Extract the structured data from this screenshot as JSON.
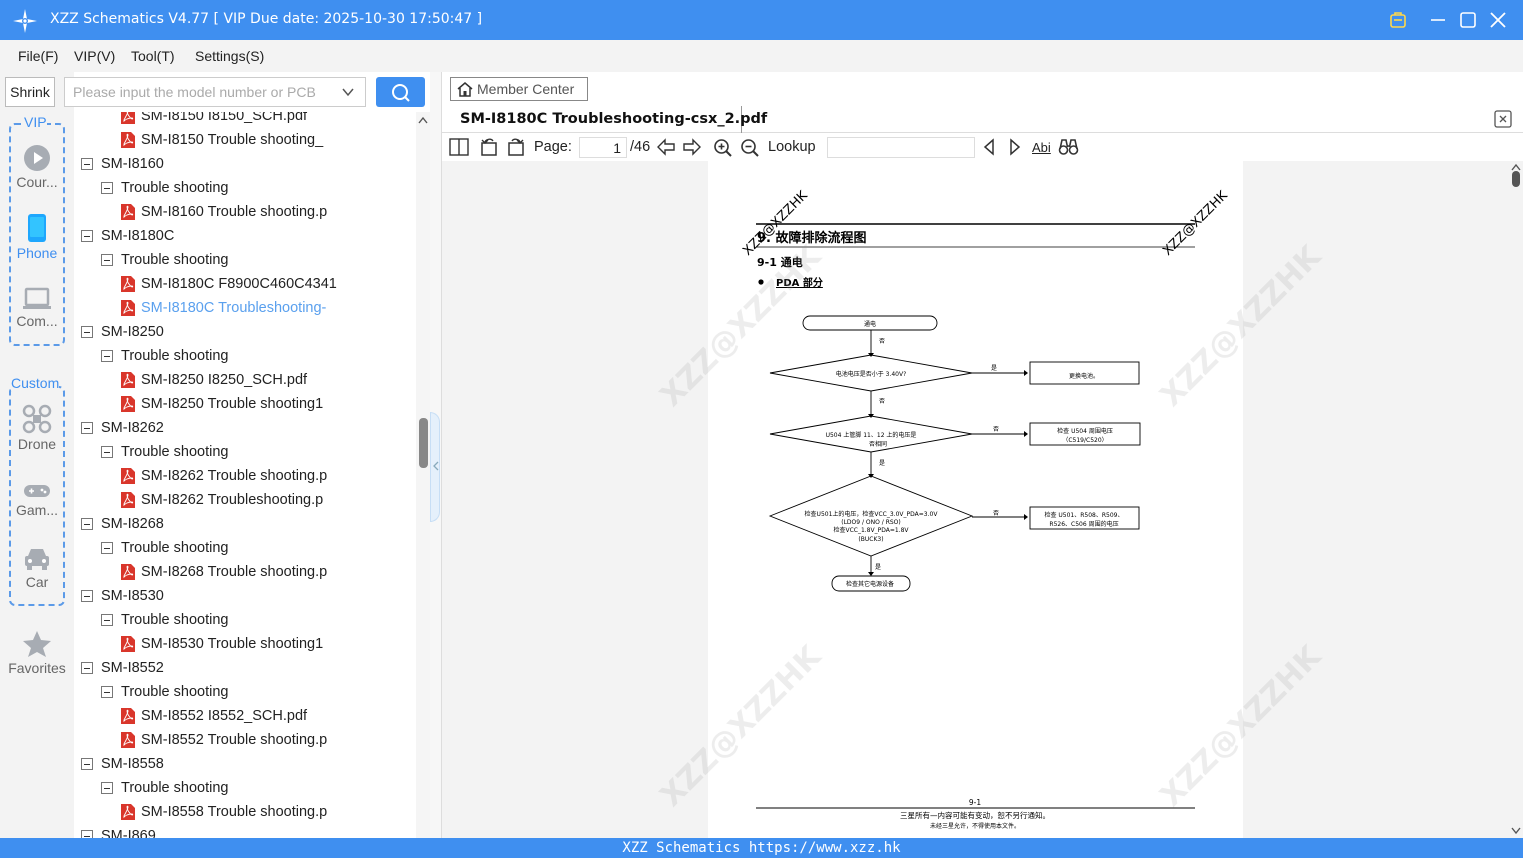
{
  "window": {
    "title": "XZZ Schematics V4.77 [ VIP Due date: 2025-10-30 17:50:47 ]",
    "accent": "#3f8ff0"
  },
  "menu": [
    "File(F)",
    "VIP(V)",
    "Tool(T)",
    "Settings(S)"
  ],
  "search": {
    "shrink_label": "Shrink",
    "placeholder": "Please input the model number or PCB"
  },
  "sidebar": {
    "vip_group": "VIP",
    "custom_group": "Custom",
    "categories": [
      {
        "label": "Cour...",
        "icon": "play-icon"
      },
      {
        "label": "Phone",
        "icon": "phone-icon"
      },
      {
        "label": "Com...",
        "icon": "laptop-icon"
      },
      {
        "label": "Drone",
        "icon": "drone-icon"
      },
      {
        "label": "Gam...",
        "icon": "gamepad-icon"
      },
      {
        "label": "Car",
        "icon": "car-icon"
      },
      {
        "label": "Favorites",
        "icon": "star-icon"
      }
    ]
  },
  "tree": [
    {
      "level": 2,
      "type": "pdf",
      "text": "SM-I8150 I8150_SCH.pdf"
    },
    {
      "level": 2,
      "type": "pdf",
      "text": "SM-I8150 Trouble shooting_"
    },
    {
      "level": 0,
      "type": "folder",
      "text": "SM-I8160"
    },
    {
      "level": 1,
      "type": "folder",
      "text": "Trouble shooting"
    },
    {
      "level": 2,
      "type": "pdf",
      "text": "SM-I8160 Trouble shooting.p"
    },
    {
      "level": 0,
      "type": "folder",
      "text": "SM-I8180C"
    },
    {
      "level": 1,
      "type": "folder",
      "text": "Trouble shooting"
    },
    {
      "level": 2,
      "type": "pdf",
      "text": "SM-I8180C F8900C460C4341"
    },
    {
      "level": 2,
      "type": "pdf",
      "text": "SM-I8180C Troubleshooting-",
      "selected": true
    },
    {
      "level": 0,
      "type": "folder",
      "text": "SM-I8250"
    },
    {
      "level": 1,
      "type": "folder",
      "text": "Trouble shooting"
    },
    {
      "level": 2,
      "type": "pdf",
      "text": "SM-I8250 I8250_SCH.pdf"
    },
    {
      "level": 2,
      "type": "pdf",
      "text": "SM-I8250 Trouble shooting1"
    },
    {
      "level": 0,
      "type": "folder",
      "text": "SM-I8262"
    },
    {
      "level": 1,
      "type": "folder",
      "text": "Trouble shooting"
    },
    {
      "level": 2,
      "type": "pdf",
      "text": "SM-I8262 Trouble shooting.p"
    },
    {
      "level": 2,
      "type": "pdf",
      "text": "SM-I8262 Troubleshooting.p"
    },
    {
      "level": 0,
      "type": "folder",
      "text": "SM-I8268"
    },
    {
      "level": 1,
      "type": "folder",
      "text": "Trouble shooting"
    },
    {
      "level": 2,
      "type": "pdf",
      "text": "SM-I8268 Trouble shooting.p"
    },
    {
      "level": 0,
      "type": "folder",
      "text": "SM-I8530"
    },
    {
      "level": 1,
      "type": "folder",
      "text": "Trouble shooting"
    },
    {
      "level": 2,
      "type": "pdf",
      "text": "SM-I8530 Trouble shooting1"
    },
    {
      "level": 0,
      "type": "folder",
      "text": "SM-I8552"
    },
    {
      "level": 1,
      "type": "folder",
      "text": "Trouble shooting"
    },
    {
      "level": 2,
      "type": "pdf",
      "text": "SM-I8552 I8552_SCH.pdf"
    },
    {
      "level": 2,
      "type": "pdf",
      "text": "SM-I8552 Trouble shooting.p"
    },
    {
      "level": 0,
      "type": "folder",
      "text": "SM-I8558"
    },
    {
      "level": 1,
      "type": "folder",
      "text": "Trouble shooting"
    },
    {
      "level": 2,
      "type": "pdf",
      "text": "SM-I8558 Trouble shooting.p"
    },
    {
      "level": 0,
      "type": "folder",
      "text": "SM-I869"
    }
  ],
  "viewer": {
    "member_center": "Member Center",
    "tab_title": "SM-I8180C Troubleshooting-csx_2.pdf",
    "page_label": "Page:",
    "page_current": "1",
    "page_total": "/46",
    "lookup_label": "Lookup",
    "abi_label": "Abi"
  },
  "document": {
    "heading": "9.  故障排除流程图",
    "sub_heading": "9-1  通电",
    "bullet": "PDA 部分",
    "watermark": "XZZ@XZZHK",
    "flow": {
      "start": "通电",
      "d1": "电池电压是否小于 3.40V?",
      "a1": "更换电池。",
      "d2_line1": "U504 上管脚 11、12 上的电压是",
      "d2_line2": "否相同",
      "a2_line1": "检查 U504 周围电压",
      "a2_line2": "（C519/C520）",
      "d3_line1": "检查U501上的电压，检查VCC_3.0V_PDA=3.0V",
      "d3_line2": "(LDO9 / ONO / RSO)",
      "d3_line3": "检查VCC_1.8V_PDA=1.8V",
      "d3_line4": "(BUCK3)",
      "a3_line1": "检查 U501、R508、R509、",
      "a3_line2": "R526、C506 周围的电压",
      "end": "检查其它电源设备",
      "yes": "是",
      "no": "否"
    },
    "page_number": "9-1",
    "footer_line1": "三星所有—内容可能有变动，恕不另行通知。",
    "footer_line2": "未经三星允许，不得使用本文件。"
  },
  "footer": "XZZ Schematics https://www.xzz.hk"
}
